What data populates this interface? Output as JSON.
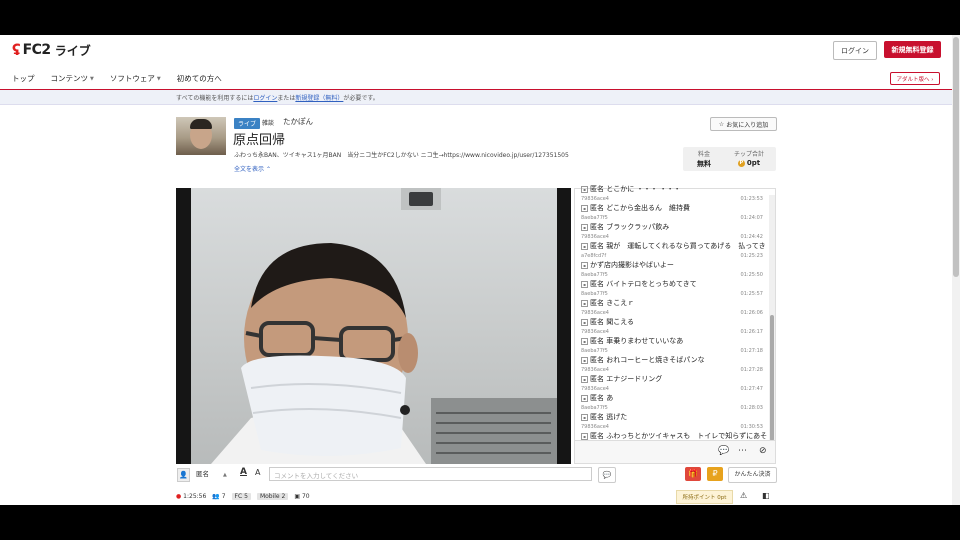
{
  "header": {
    "logo_text": "FC2",
    "logo_sub": "ライブ",
    "login_button": "ログイン",
    "register_button": "新規無料登録",
    "adult_button": "アダルト版へ ›"
  },
  "nav": {
    "items": [
      {
        "label": "トップ",
        "has_menu": false
      },
      {
        "label": "コンテンツ",
        "has_menu": true
      },
      {
        "label": "ソフトウェア",
        "has_menu": true
      },
      {
        "label": "初めての方へ",
        "has_menu": false
      }
    ]
  },
  "notice": {
    "prefix": "すべての機能を利用するには",
    "login_link": "ログイン",
    "middle": "または",
    "register_link": "新規登録（無料）",
    "suffix": "が必要です。"
  },
  "channel": {
    "status_tag": "ライブ",
    "category": "雑談",
    "owner": "たかぽん",
    "title": "原点回帰",
    "description": "ふわっち永BAN、ツイキャス1ヶ月BAN　当分ニコ生かFC2しかない ニコ生→https://www.nicovideo.jp/user/127351505",
    "show_all": "全文を表示",
    "favorite_button": "お気に入り追加",
    "fee_label": "料金",
    "fee_value": "無料",
    "tip_label": "チップ合計",
    "tip_value": "0pt"
  },
  "chat": {
    "messages": [
      {
        "uid": "",
        "time": "",
        "name": "",
        "text": "匿名 とこかに ・・・ ・・・"
      },
      {
        "uid": "79836ace4",
        "time": "01:23:53",
        "text": "匿名 どこから金出るん　維持費"
      },
      {
        "uid": "8aeba77f5",
        "time": "01:24:07",
        "text": "匿名 ブラックラッパ飲み"
      },
      {
        "uid": "79836ace4",
        "time": "01:24:42",
        "text": "匿名 親が　運転してくれるなら買ってあげる　払ってき"
      },
      {
        "uid": "a7e8fcd7f",
        "time": "01:25:23",
        "text": "かず店内撮影はやばいよー"
      },
      {
        "uid": "8aeba77f5",
        "time": "01:25:50",
        "text": "匿名 バイトテロをとっちめてきて"
      },
      {
        "uid": "8aeba77f5",
        "time": "01:25:57",
        "text": "匿名 きこえｒ"
      },
      {
        "uid": "79836ace4",
        "time": "01:26:06",
        "text": "匿名 聞こえる"
      },
      {
        "uid": "79836ace4",
        "time": "01:26:17",
        "text": "匿名 車乗りまわせていいなあ"
      },
      {
        "uid": "8aeba77f5",
        "time": "01:27:18",
        "text": "匿名 おれコーヒーと焼きそばパンな"
      },
      {
        "uid": "79836ace4",
        "time": "01:27:28",
        "text": "匿名 エナジードリング"
      },
      {
        "uid": "79836ace4",
        "time": "01:27:47",
        "text": "匿名 あ"
      },
      {
        "uid": "8aeba77f5",
        "time": "01:28:03",
        "text": "匿名 逃げた"
      },
      {
        "uid": "79836ace4",
        "time": "01:30:53",
        "text": "匿名 ふわっちとかツイキャスも　トイレで知らずにあそ"
      }
    ]
  },
  "comment": {
    "name_select": "匿名",
    "placeholder": "コメントを入力してください",
    "quick_pay": "かんたん決済"
  },
  "stats": {
    "elapsed": "1:25:56",
    "viewers": "7",
    "fc_badge": "FC",
    "fc_count": "5",
    "mobile_badge": "Mobile",
    "mobile_count": "2",
    "total": "70",
    "points": "所持ポイント 0pt"
  },
  "colors": {
    "brand": "#c8102e",
    "link": "#3060c0",
    "live_tag": "#3b82c4"
  }
}
